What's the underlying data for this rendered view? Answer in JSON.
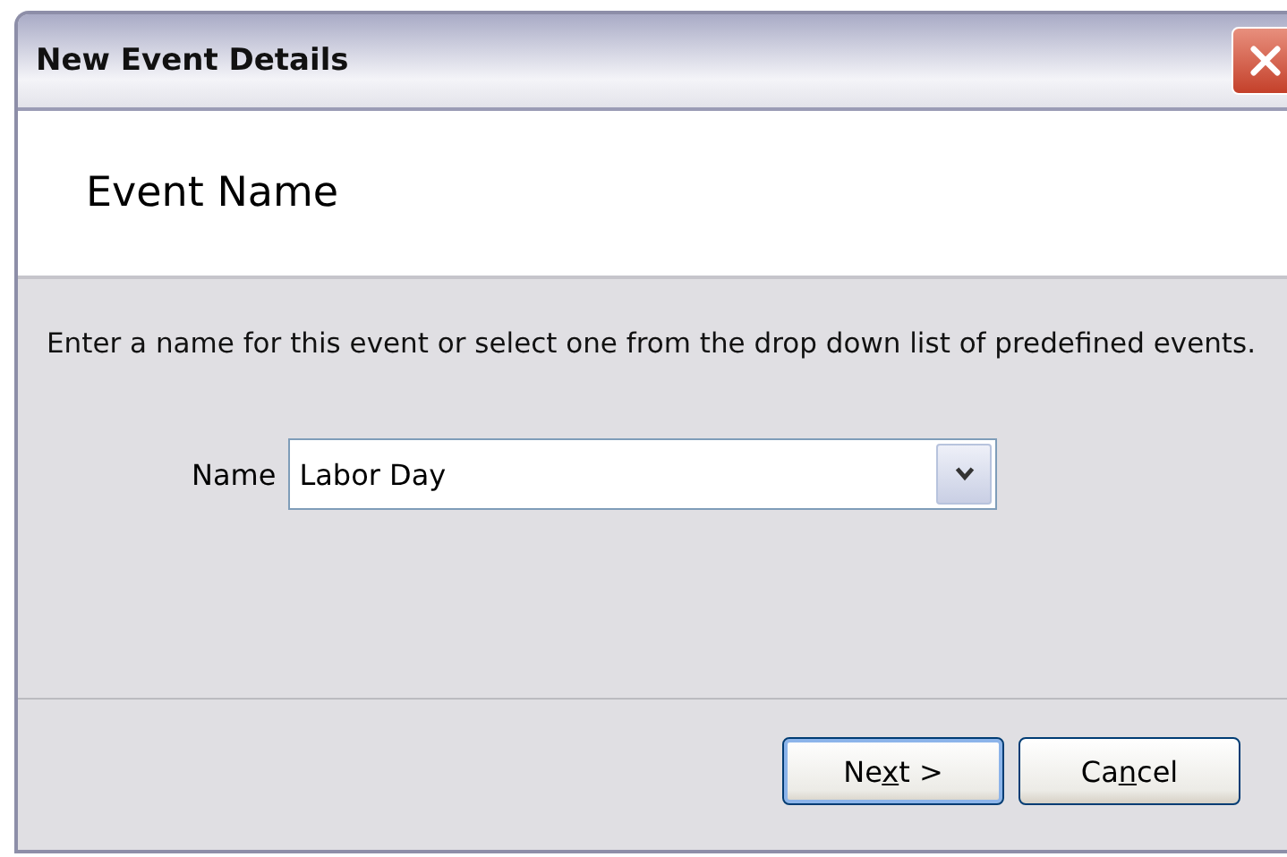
{
  "window": {
    "title": "New Event Details"
  },
  "header": {
    "title": "Event Name"
  },
  "instructions": "Enter a name for this event or select one from the drop down list of predefined events.",
  "name_field": {
    "label": "Name",
    "value": "Labor Day"
  },
  "buttons": [
    {
      "before": "Ne",
      "mnemonic": "x",
      "after": "t >",
      "default": true
    },
    {
      "before": "Ca",
      "mnemonic": "n",
      "after": "cel",
      "default": false
    }
  ]
}
